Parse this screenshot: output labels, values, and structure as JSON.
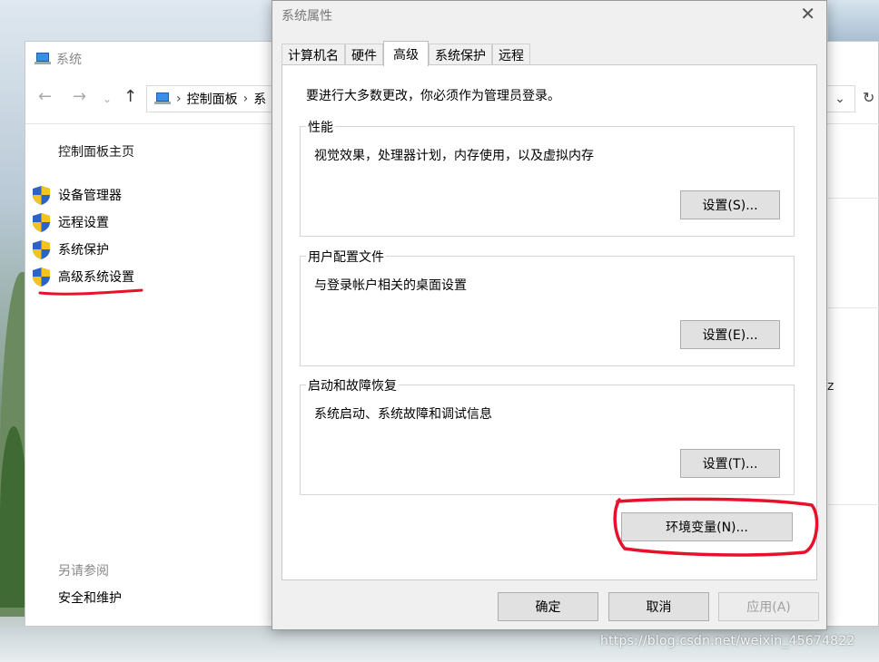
{
  "background_window": {
    "title": "系统",
    "breadcrumb": [
      "控制面板",
      "系"
    ],
    "sidebar_home": "控制面板主页",
    "sidebar_items": [
      "设备管理器",
      "远程设置",
      "系统保护",
      "高级系统设置"
    ],
    "see_also_label": "另请参阅",
    "security_link": "安全和维护",
    "partial_text": "z"
  },
  "dialog": {
    "title": "系统属性",
    "tabs": [
      "计算机名",
      "硬件",
      "高级",
      "系统保护",
      "远程"
    ],
    "active_tab": "高级",
    "admin_note": "要进行大多数更改，你必须作为管理员登录。",
    "performance": {
      "label": "性能",
      "desc": "视觉效果，处理器计划，内存使用，以及虚拟内存",
      "button": "设置(S)..."
    },
    "user_profiles": {
      "label": "用户配置文件",
      "desc": "与登录帐户相关的桌面设置",
      "button": "设置(E)..."
    },
    "startup_recovery": {
      "label": "启动和故障恢复",
      "desc": "系统启动、系统故障和调试信息",
      "button": "设置(T)..."
    },
    "env_vars_button": "环境变量(N)...",
    "ok_button": "确定",
    "cancel_button": "取消",
    "apply_button": "应用(A)"
  },
  "annotation_color": "#e8102a",
  "watermark": "https://blog.csdn.net/weixin_45674822"
}
